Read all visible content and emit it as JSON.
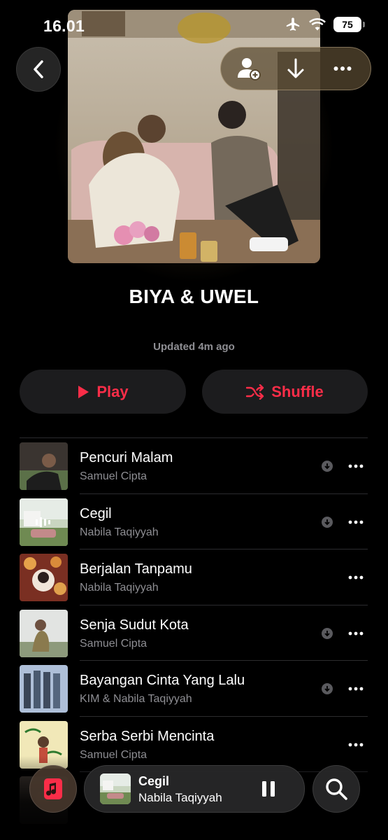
{
  "status_bar": {
    "time": "16.01",
    "battery": "75"
  },
  "playlist": {
    "title": "BIYA & UWEL",
    "updated": "Updated 4m ago"
  },
  "buttons": {
    "play": "Play",
    "shuffle": "Shuffle"
  },
  "songs": [
    {
      "title": "Pencuri Malam",
      "artist": "Samuel Cipta",
      "downloaded": true
    },
    {
      "title": "Cegil",
      "artist": "Nabila Taqiyyah",
      "downloaded": true,
      "now_playing": true
    },
    {
      "title": "Berjalan Tanpamu",
      "artist": "Nabila Taqiyyah",
      "downloaded": false
    },
    {
      "title": "Senja Sudut Kota",
      "artist": "Samuel Cipta",
      "downloaded": true
    },
    {
      "title": "Bayangan Cinta Yang Lalu",
      "artist": "KIM & Nabila Taqiyyah",
      "downloaded": true
    },
    {
      "title": "Serba Serbi Mencinta",
      "artist": "Samuel Cipta",
      "downloaded": false
    }
  ],
  "mini_player": {
    "title": "Cegil",
    "artist": "Nabila Taqiyyah"
  },
  "colors": {
    "accent": "#fa2d48",
    "background": "#000000",
    "button_bg": "#1c1c1e",
    "secondary_text": "#8e8e93"
  },
  "icons": {
    "back": "chevron-left-icon",
    "add_contributor": "person-plus-icon",
    "download": "arrow-down-icon",
    "more": "ellipsis-icon",
    "play": "play-icon",
    "shuffle": "shuffle-icon",
    "library": "music-note-icon",
    "pause": "pause-icon",
    "search": "magnifier-icon"
  }
}
